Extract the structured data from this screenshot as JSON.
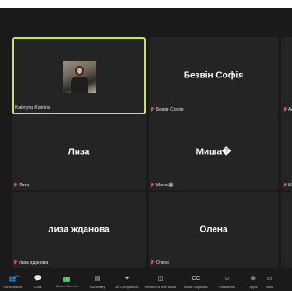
{
  "tiles": [
    {
      "id": "kateryna",
      "name": "Kateryna Kobrina",
      "display": "",
      "has_video": true
    },
    {
      "id": "sofia",
      "name": "Безвін Софія",
      "display": "Безвін Софія",
      "has_video": false
    },
    {
      "id": "liza",
      "name": "Лиза",
      "display": "Лиза",
      "has_video": false
    },
    {
      "id": "misha",
      "name": "Миша🏵",
      "display": "Миша�",
      "has_video": false
    },
    {
      "id": "liza-zh",
      "name": "лиза жданова",
      "display": "лиза жданова",
      "has_video": false
    },
    {
      "id": "olena",
      "name": "Олена",
      "display": "Олена",
      "has_video": false
    }
  ],
  "edge": {
    "right_top_caption": "Ar",
    "right_mid_caption": "И"
  },
  "toolbar": {
    "items": [
      {
        "icon": "participants-icon",
        "label": "Participants",
        "count": "10"
      },
      {
        "icon": "chat-icon",
        "label": "Chat"
      },
      {
        "icon": "share-screen-icon",
        "label": "Share Screen"
      },
      {
        "icon": "summary-icon",
        "label": "Summary"
      },
      {
        "icon": "ai-companion-icon",
        "label": "AI Companion"
      },
      {
        "icon": "record-icon",
        "label": "Record to the cloud"
      },
      {
        "icon": "show-captions-icon",
        "label": "Show Captions"
      },
      {
        "icon": "reactions-icon",
        "label": "Reactions"
      },
      {
        "icon": "apps-icon",
        "label": "Apps"
      },
      {
        "icon": "whiteboards-icon",
        "label": "Whit"
      }
    ]
  },
  "colors": {
    "active_border": "#c6e84a",
    "tile_bg": "#242424",
    "app_bg": "#1a1a1a",
    "mic_off": "#e34b4b",
    "share": "#3ec46d"
  }
}
